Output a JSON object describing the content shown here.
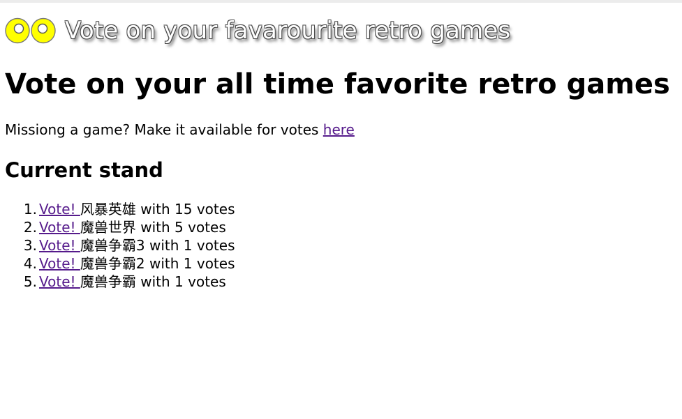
{
  "banner": {
    "logo_icon": "yellow-eyes-logo-icon",
    "title": "Vote on your favarourite retro games"
  },
  "heading": "Vote on your all time favorite retro games",
  "intro": {
    "text": "Missiong a game? Make it available for votes ",
    "link_label": "here"
  },
  "section_heading": "Current stand",
  "standings": [
    {
      "rank": "1.",
      "vote_label": "Vote! ",
      "game": "风暴英雄",
      "tally": " with 15 votes"
    },
    {
      "rank": "2.",
      "vote_label": "Vote! ",
      "game": "魔兽世界",
      "tally": " with 5 votes"
    },
    {
      "rank": "3.",
      "vote_label": "Vote! ",
      "game": "魔兽争霸3",
      "tally": " with 1 votes"
    },
    {
      "rank": "4.",
      "vote_label": "Vote! ",
      "game": "魔兽争霸2",
      "tally": " with 1 votes"
    },
    {
      "rank": "5.",
      "vote_label": "Vote! ",
      "game": "魔兽争霸",
      "tally": " with 1 votes"
    }
  ],
  "colors": {
    "link": "#551a8b",
    "logo_fill": "#ffff00",
    "logo_outline": "#777777"
  }
}
